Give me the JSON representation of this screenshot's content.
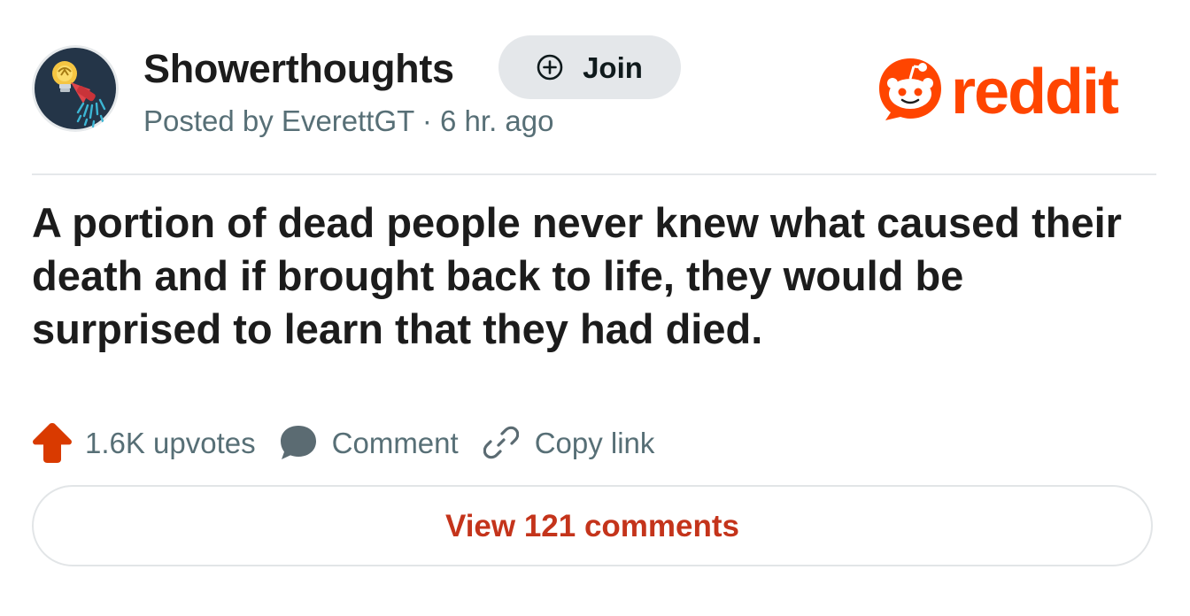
{
  "header": {
    "subreddit": "Showerthoughts",
    "join_label": "Join",
    "meta": "Posted by EverettGT · 6 hr. ago",
    "brand": "reddit",
    "brand_color": "#ff4500"
  },
  "post": {
    "title": "A portion of dead people never knew what caused their death and if brought back to life, they would be surprised to learn that they had died."
  },
  "actions": {
    "upvotes": "1.6K upvotes",
    "comment": "Comment",
    "copy_link": "Copy link"
  },
  "footer": {
    "view_comments": "View 121 comments"
  },
  "icons": {
    "avatar": "lightbulb-showerhead-icon",
    "join": "plus-circle-icon",
    "upvote": "upvote-arrow-icon",
    "comment": "speech-bubble-icon",
    "copy": "link-icon"
  },
  "colors": {
    "upvote": "#d93a00",
    "view_comments_text": "#c4341b",
    "muted_text": "#576f76"
  }
}
